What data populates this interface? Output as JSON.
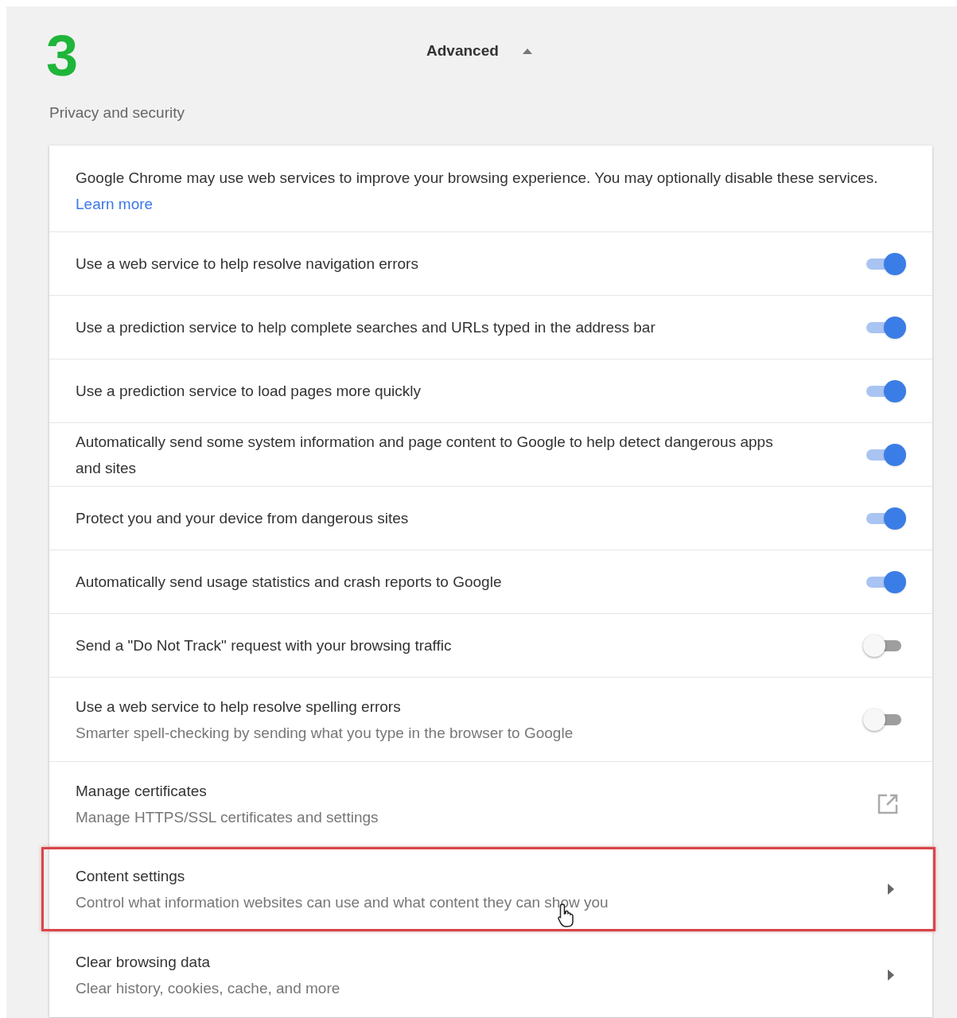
{
  "step_number": "3",
  "advanced": {
    "label": "Advanced",
    "expanded": true
  },
  "section_title": "Privacy and security",
  "intro": {
    "text": "Google Chrome may use web services to improve your browsing experience. You may optionally disable these services.",
    "link": "Learn more"
  },
  "items": [
    {
      "kind": "toggle",
      "label": "Use a web service to help resolve navigation errors",
      "on": true
    },
    {
      "kind": "toggle",
      "label": "Use a prediction service to help complete searches and URLs typed in the address bar",
      "on": true
    },
    {
      "kind": "toggle",
      "label": "Use a prediction service to load pages more quickly",
      "on": true
    },
    {
      "kind": "toggle",
      "label": "Automatically send some system information and page content to Google to help detect dangerous apps and sites",
      "on": true
    },
    {
      "kind": "toggle",
      "label": "Protect you and your device from dangerous sites",
      "on": true
    },
    {
      "kind": "toggle",
      "label": "Automatically send usage statistics and crash reports to Google",
      "on": true
    },
    {
      "kind": "toggle",
      "label": "Send a \"Do Not Track\" request with your browsing traffic",
      "on": false
    },
    {
      "kind": "toggle",
      "label": "Use a web service to help resolve spelling errors",
      "sublabel": "Smarter spell-checking by sending what you type in the browser to Google",
      "on": false
    },
    {
      "kind": "external",
      "label": "Manage certificates",
      "sublabel": "Manage HTTPS/SSL certificates and settings",
      "highlighted": false
    },
    {
      "kind": "submenu",
      "label": "Content settings",
      "sublabel": "Control what information websites can use and what content they can show you",
      "highlighted": true
    },
    {
      "kind": "submenu",
      "label": "Clear browsing data",
      "sublabel": "Clear history, cookies, cache, and more",
      "highlighted": false
    }
  ]
}
